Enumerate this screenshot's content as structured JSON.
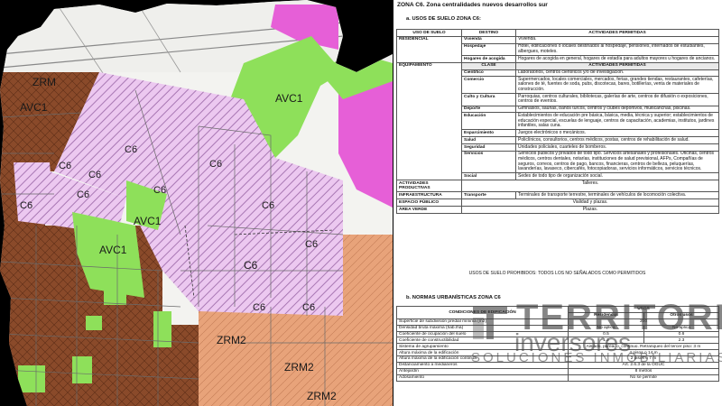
{
  "map": {
    "zones": {
      "avc1_top": "AVC1",
      "avc1_left": "AVC1",
      "avc1_mid": "AVC1",
      "avc1_low": "AVC1",
      "zrm_tl": "ZRM",
      "zrm_b1": "ZRM2",
      "zrm_b2": "ZRM2",
      "zrm_b3": "ZRM2",
      "c6_1": "C6",
      "c6_2": "C6",
      "c6_3": "C6",
      "c6_4": "C6",
      "c6_5": "C6",
      "c6_6": "C6",
      "c6_7": "C6",
      "c6_8": "C6",
      "c6_9": "C6",
      "c6_10": "C6",
      "c6_11": "C6",
      "c6_12": "C6"
    },
    "colors": {
      "residential": "#8a4a2a",
      "green": "#8ee05a",
      "mixed": "#e9c6ee",
      "magenta": "#e65fd7",
      "orange": "#e8a37a",
      "blank": "#f4f4f2"
    }
  },
  "doc": {
    "title": "ZONA C6. Zona centralidades nuevos desarrollos sur",
    "section_a": "a.     USOS DE SUELO ZONA C6:",
    "uses_header": {
      "uso": "USO DE SUELO",
      "destino": "DESTINO",
      "actividades": "ACTIVIDADES PERMITIDAS"
    },
    "residencial": {
      "cat": "RESIDENCIAL",
      "rows": [
        {
          "sub": "Vivienda",
          "act": "Vivienda."
        },
        {
          "sub": "Hospedaje",
          "act": "Hotel, edificaciones o locales destinados al hospedaje, pensiones, internados de estudiantes, albergues, moteles."
        },
        {
          "sub": "Hogares de acogida",
          "act": "Hogares de acogida en general, hogares de estadía para adultos mayores u hogares de ancianos."
        }
      ]
    },
    "equipamiento": {
      "cat": "EQUIPAMIENTO",
      "clase": "CLASE",
      "act_header": "ACTIVIDADES PERMITIDAS",
      "rows": [
        {
          "sub": "Científico",
          "act": "Laboratorios, centros científicos y/o de investigación."
        },
        {
          "sub": "Comercio",
          "act": "Supermercados, locales comerciales, mercados, ferias, grandes tiendas, restaurantes, cafeterías, salones de té, fuentes de soda, pubs, discotecas, bares, botillerías, venta de materiales de construcción."
        },
        {
          "sub": "Culto y Cultura",
          "act": "Parroquias, centros culturales, bibliotecas, galerías de arte, centros de difusión o exposiciones, centros de eventos."
        },
        {
          "sub": "Deporte",
          "act": "Gimnasios, saunas, baños turcos, centros y clubes deportivos, multicanchas, piscinas."
        },
        {
          "sub": "Educación",
          "act": "Establecimientos de educación pre básica, básica, media, técnica y superior; establecimientos de educación especial, escuelas de lenguaje, centros de capacitación, academias, institutos, jardines infantiles, salas cuna."
        },
        {
          "sub": "Esparcimiento",
          "act": "Juegos electrónicos o mecánicos."
        },
        {
          "sub": "Salud",
          "act": "Policlínicos, consultorios, centros médicos, postas, centros de rehabilitación de salud."
        },
        {
          "sub": "Seguridad",
          "act": "Unidades policiales, cuarteles de bomberos."
        },
        {
          "sub": "Servicios",
          "act": "Servicios públicos y privados de todo tipo. Servicios artesanales y profesionales. Oficinas, centros médicos, centros dentales, notarías, instituciones de salud previsional, AFPs, Compañías de seguros, correos, centros de pago, bancos, financieras, centros de belleza, peluquerías, lavanderías, lavaseco, cibercafés, fotocopiadoras, servicios informáticos, servicios técnicos."
        },
        {
          "sub": "Social",
          "act": "Sedes de todo tipo de organización social."
        }
      ]
    },
    "otros": [
      {
        "cat": "ACTIVIDADES PRODUCTIVAS",
        "sub": "",
        "act": "Talleres."
      },
      {
        "cat": "INFRAESTRUCTURA",
        "sub": "Transporte",
        "act": "Terminales de transporte terrestre, terminales de vehículos de locomoción colectiva."
      },
      {
        "cat": "ESPACIO PÚBLICO",
        "sub": "",
        "act": "Vialidad y plazas."
      },
      {
        "cat": "ÁREA VERDE",
        "sub": "",
        "act": "Plazas."
      }
    ],
    "prohibidos": "USOS DE SUELO PROHIBIDOS: TODOS LOS NO SEÑALADOS COMO PERMITIDOS",
    "section_b": "b.     NORMAS URBANÍSTICAS ZONA C6",
    "norms_header": {
      "cond": "CONDICIONES DE EDIFICACIÓN",
      "usos": "USOS",
      "residencial": "Residencial",
      "otros": "Otros usos"
    },
    "norms": [
      {
        "label": "Superficie de subdivisión predial mínima (m2)",
        "a": "200",
        "b": ""
      },
      {
        "label": "Densidad bruta máxima (hab./há)",
        "a": "No aplica",
        "b": "No aplica"
      },
      {
        "label": "Coeficiente de ocupación del suelo",
        "a": "0.5",
        "b": "0.6"
      },
      {
        "label": "Coeficiente de constructibilidad",
        "a": "1.2",
        "b": "2.3"
      },
      {
        "label": "Sistema de agrupamiento",
        "a": "Aislado, pareado, continuo. Retranqueo del tercer piso: 3 m",
        "b": ""
      },
      {
        "label": "Altura máxima de la edificación",
        "a": "4 pisos o 14 m",
        "b": ""
      },
      {
        "label": "Altura máxima de la edificación continua",
        "a": "2 pisos o 7 m",
        "b": ""
      },
      {
        "label": "Distanciamiento a medianeros",
        "a": "Art. 2.6.3 de la OGUC",
        "b": ""
      },
      {
        "label": "Antejardín",
        "a": "8 metros",
        "b": ""
      },
      {
        "label": "Adosamiento",
        "a": "No se permite",
        "b": ""
      }
    ]
  },
  "logo": {
    "line1": "TERRITORIO",
    "line2": "inversores",
    "line3": "SOLUCIONES INMOBILIARIAS"
  }
}
